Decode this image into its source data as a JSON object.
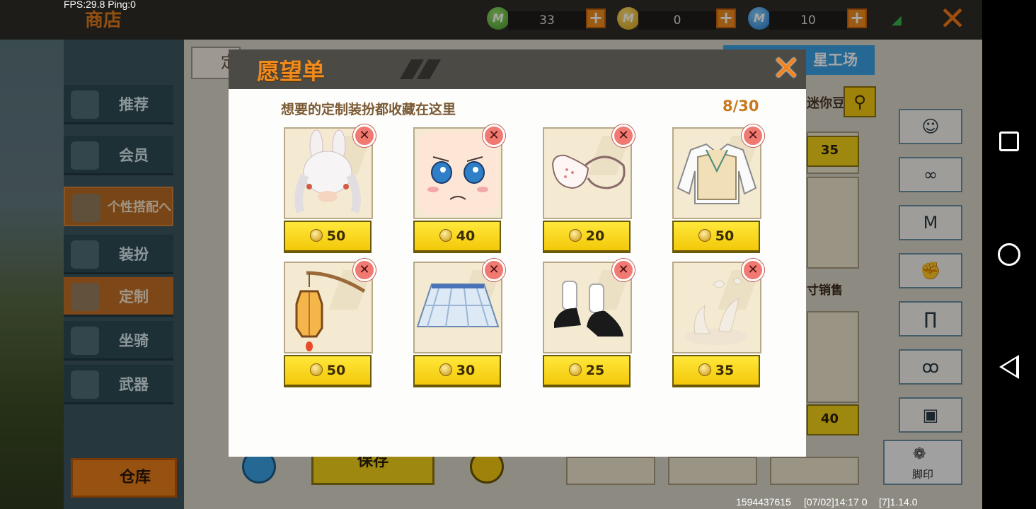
{
  "status": {
    "fps_text": "FPS:29.8  Ping:0"
  },
  "header": {
    "title": "商店",
    "currencies": [
      {
        "icon": "green-coin-icon",
        "value": "33"
      },
      {
        "icon": "gold-coin-icon",
        "value": "0"
      },
      {
        "icon": "blue-coin-icon",
        "value": "10"
      }
    ],
    "plus_label": "+",
    "close_label": "✕"
  },
  "sidebar": {
    "items": [
      {
        "label": "推荐"
      },
      {
        "label": "会员"
      },
      {
        "label": "个性搭配へ"
      },
      {
        "label": "装扮"
      },
      {
        "label": "定制"
      },
      {
        "label": "坐骑"
      },
      {
        "label": "武器"
      }
    ],
    "warehouse_label": "仓库"
  },
  "main": {
    "tab_label": "定",
    "workshop_label": "星工场",
    "search_label": "迷你豆",
    "prices": [
      "35",
      "40"
    ],
    "sale_label": "寸销售",
    "save_label": "保存",
    "footprint_label": "脚印"
  },
  "wishlist": {
    "title": "愿望单",
    "subtitle": "想要的定制装扮都收藏在这里",
    "count": "8/30",
    "items": [
      {
        "name": "bunny-ear-hair",
        "price": "50"
      },
      {
        "name": "worried-face",
        "price": "40"
      },
      {
        "name": "face-mask",
        "price": "20"
      },
      {
        "name": "sweater-vest",
        "price": "50"
      },
      {
        "name": "lantern",
        "price": "50"
      },
      {
        "name": "plaid-skirt",
        "price": "30"
      },
      {
        "name": "mary-jane-shoes",
        "price": "25"
      },
      {
        "name": "feather-effect",
        "price": "35"
      }
    ]
  },
  "footer": {
    "uid": "1594437615",
    "timestamp": "[07/02]14:17 0",
    "version": "[7]1.14.0"
  },
  "colors": {
    "accent": "#f28b1e",
    "price_yellow": "#f5d21a",
    "remove_red": "#f07a72"
  }
}
